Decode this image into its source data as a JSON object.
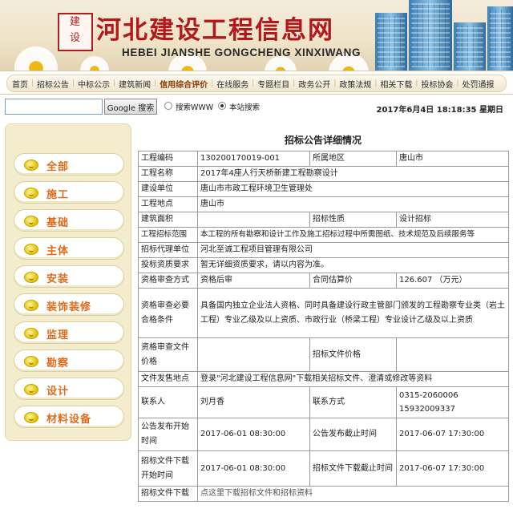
{
  "banner": {
    "seal_text": "建\n设",
    "title": "河北建设工程信息网",
    "subtitle": "HEBEI JIANSHE GONGCHENG XINXIWANG"
  },
  "nav": {
    "items": [
      "首页",
      "招标公告",
      "中标公示",
      "建筑新闻",
      "信用综合评价",
      "在线服务",
      "专题栏目",
      "政务公开",
      "政策法规",
      "相关下载",
      "投标协会",
      "处罚通报"
    ],
    "active_index": 4
  },
  "search": {
    "input_value": "",
    "google_button": "Google 搜索",
    "radio_www": "搜索WWW",
    "radio_site": "本站搜索",
    "selected": "site"
  },
  "datetime": "2017年6月4日 18:18:35 星期日",
  "sidebar": {
    "items": [
      "全部",
      "施工",
      "基础",
      "主体",
      "安装",
      "装饰装修",
      "监理",
      "勘察",
      "设计",
      "材料设备"
    ]
  },
  "content": {
    "title": "招标公告详细情况",
    "rows": {
      "project_no_label": "工程编码",
      "project_no": "130200170019-001",
      "region_label": "所属地区",
      "region": "唐山市",
      "name_label": "工程名称",
      "name": "2017年4座人行天桥新建工程勘察设计",
      "builder_label": "建设单位",
      "builder": "唐山市市政工程环境卫生管理处",
      "location_label": "工程地点",
      "location": "唐山市",
      "area_label": "建筑面积",
      "area": "",
      "nature_label": "招标性质",
      "nature": "设计招标",
      "scope_label": "工程招标范围",
      "scope": "本工程的所有勘察和设计工作及施工招标过程中所需图纸、技术规范及后续服务等",
      "agent_label": "招标代理单位",
      "agent": "河北至诚工程项目管理有限公司",
      "qual_req_label": "投标资质要求",
      "qual_req": "暂无详细资质要求，请以内容为准。",
      "review_mode_label": "资格审查方式",
      "review_mode": "资格后审",
      "price_label": "合同估算价",
      "price": "126.607 （万元）",
      "conditions_label": "资格审查必要合格条件",
      "conditions": "具备国内独立企业法人资格、同时具备建设行政主管部门颁发的工程勘察专业类（岩土工程）专业乙级及以上资质、市政行业（桥梁工程）专业设计乙级及以上资质",
      "review_fee_label": "资格审查文件价格",
      "review_fee": "",
      "tender_fee_label": "招标文件价格",
      "tender_fee": "",
      "issue_place_label": "文件发售地点",
      "issue_place": "登录\"河北建设工程信息网\"下载相关招标文件、澄清或修改等资料",
      "contact_label": "联系人",
      "contact": "刘月香",
      "phone_label": "联系方式",
      "phone_1": "0315-2060006",
      "phone_2": "15932009337",
      "pub_start_label": "公告发布开始时间",
      "pub_start": "2017-06-01 08:30:00",
      "pub_end_label": "公告发布截止时间",
      "pub_end": "2017-06-07 17:30:00",
      "dl_start_label": "招标文件下载开始时间",
      "dl_start": "2017-06-01 08:30:00",
      "dl_end_label": "招标文件下载截止时间",
      "dl_end": "2017-06-07 17:30:00",
      "download_label": "招标文件下载",
      "download_link": "点这里下载招标文件和招标资料"
    }
  }
}
